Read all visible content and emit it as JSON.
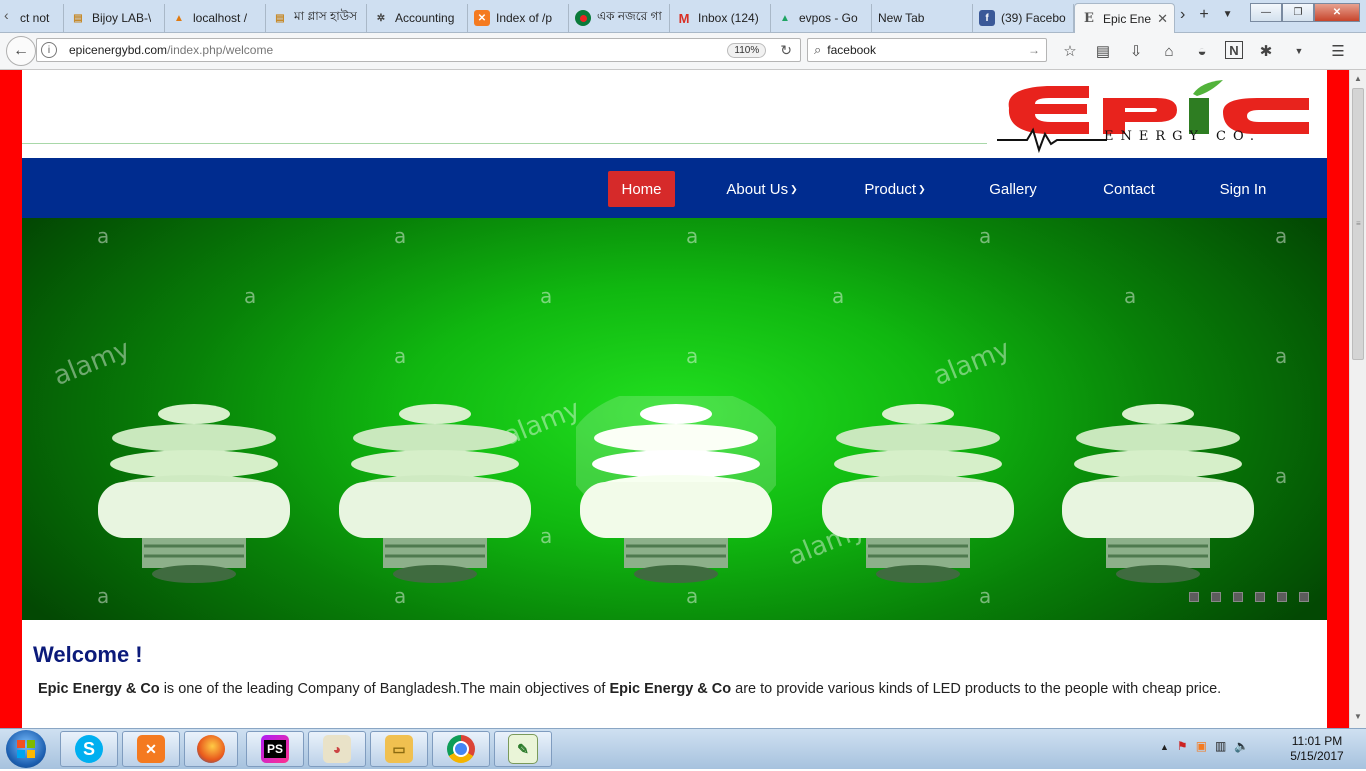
{
  "browser": {
    "tabs": [
      {
        "label": "ct not",
        "icon": "back-arrow-icon"
      },
      {
        "label": "Bijoy LAB-\\",
        "icon": "page-icon"
      },
      {
        "label": "localhost /",
        "icon": "phpmyadmin-icon"
      },
      {
        "label": "মা গ্লাস হাউস",
        "icon": "page-icon"
      },
      {
        "label": "Accounting",
        "icon": "app-icon"
      },
      {
        "label": "Index of /p",
        "icon": "xampp-icon"
      },
      {
        "label": "এক নজরে গা",
        "icon": "bangladesh-icon"
      },
      {
        "label": "Inbox (124)",
        "icon": "gmail-icon"
      },
      {
        "label": "evpos - Go",
        "icon": "drive-icon"
      },
      {
        "label": "New Tab",
        "icon": ""
      },
      {
        "label": "(39) Facebo",
        "icon": "facebook-icon"
      },
      {
        "label": "Epic Ene",
        "icon": "epic-favicon"
      }
    ],
    "url_host": "epicenergybd.com",
    "url_path": "/index.php/welcome",
    "zoom": "110%",
    "search_text": "facebook"
  },
  "site": {
    "logo_text": "EPIC",
    "logo_subtext": "ENERGY CO.",
    "nav": {
      "home": "Home",
      "about": "About Us",
      "product": "Product",
      "gallery": "Gallery",
      "contact": "Contact",
      "signin": "Sign In"
    },
    "hero": {
      "watermark_letter": "a",
      "watermark_word": "alamy",
      "slide_count": 6
    },
    "welcome": {
      "title": "Welcome !",
      "company_name": "Epic Energy & Co",
      "text_part1": " is one of the leading Company of Bangladesh.The main objectives of ",
      "text_part2": " are to provide various kinds of LED products to the people with cheap price."
    }
  },
  "taskbar": {
    "time": "11:01 PM",
    "date": "5/15/2017"
  },
  "colors": {
    "brand_red": "#ff0000",
    "nav_blue": "#002c8f",
    "active_red": "#d62a2a",
    "welcome_blue": "#0b1a7a"
  }
}
